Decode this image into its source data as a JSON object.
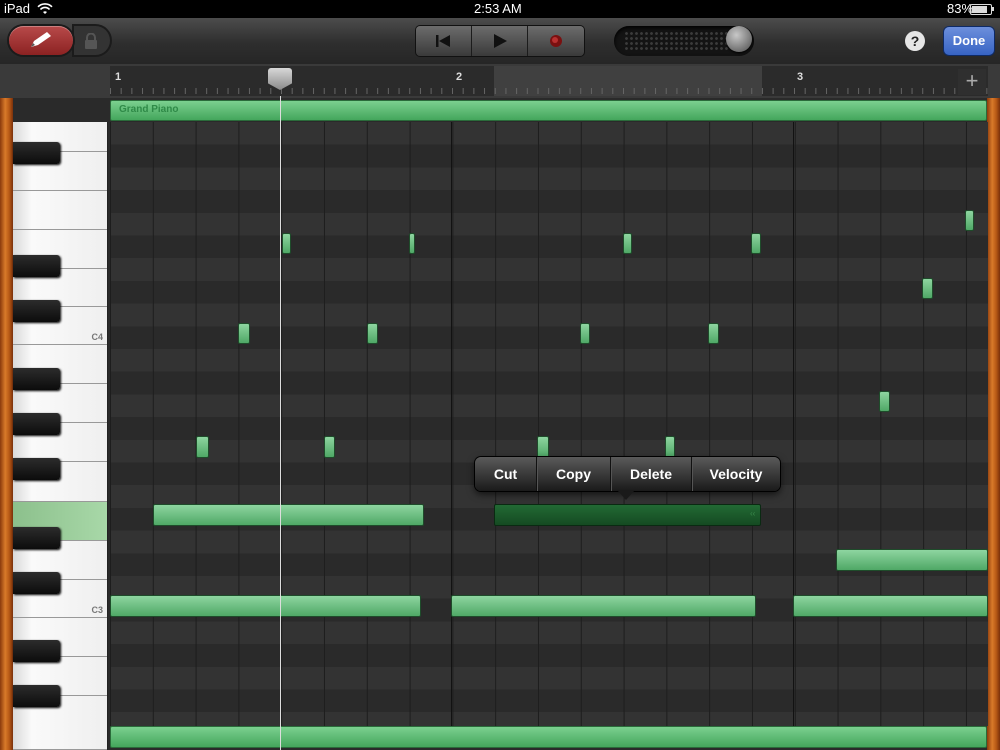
{
  "status_bar": {
    "device": "iPad",
    "time": "2:53 AM",
    "battery": "83%"
  },
  "toolbar": {
    "pencil_icon": "pencil-icon",
    "lock_icon": "lock-icon",
    "rewind_icon": "skip-to-start-icon",
    "play_icon": "play-icon",
    "record_icon": "record-icon",
    "help_label": "?",
    "done_label": "Done"
  },
  "timeline": {
    "bars": [
      "1",
      "2",
      "3"
    ],
    "add_label": "+"
  },
  "track": {
    "region_name": "Grand Piano"
  },
  "keyboard": {
    "labels": [
      "C4",
      "C3"
    ]
  },
  "context_menu": {
    "items": [
      "Cut",
      "Copy",
      "Delete",
      "Velocity"
    ]
  },
  "colors": {
    "note_green": "#5cb874",
    "selected_note": "#1f5e2e",
    "done_blue": "#3b6ccc",
    "wood": "#c8651c"
  }
}
